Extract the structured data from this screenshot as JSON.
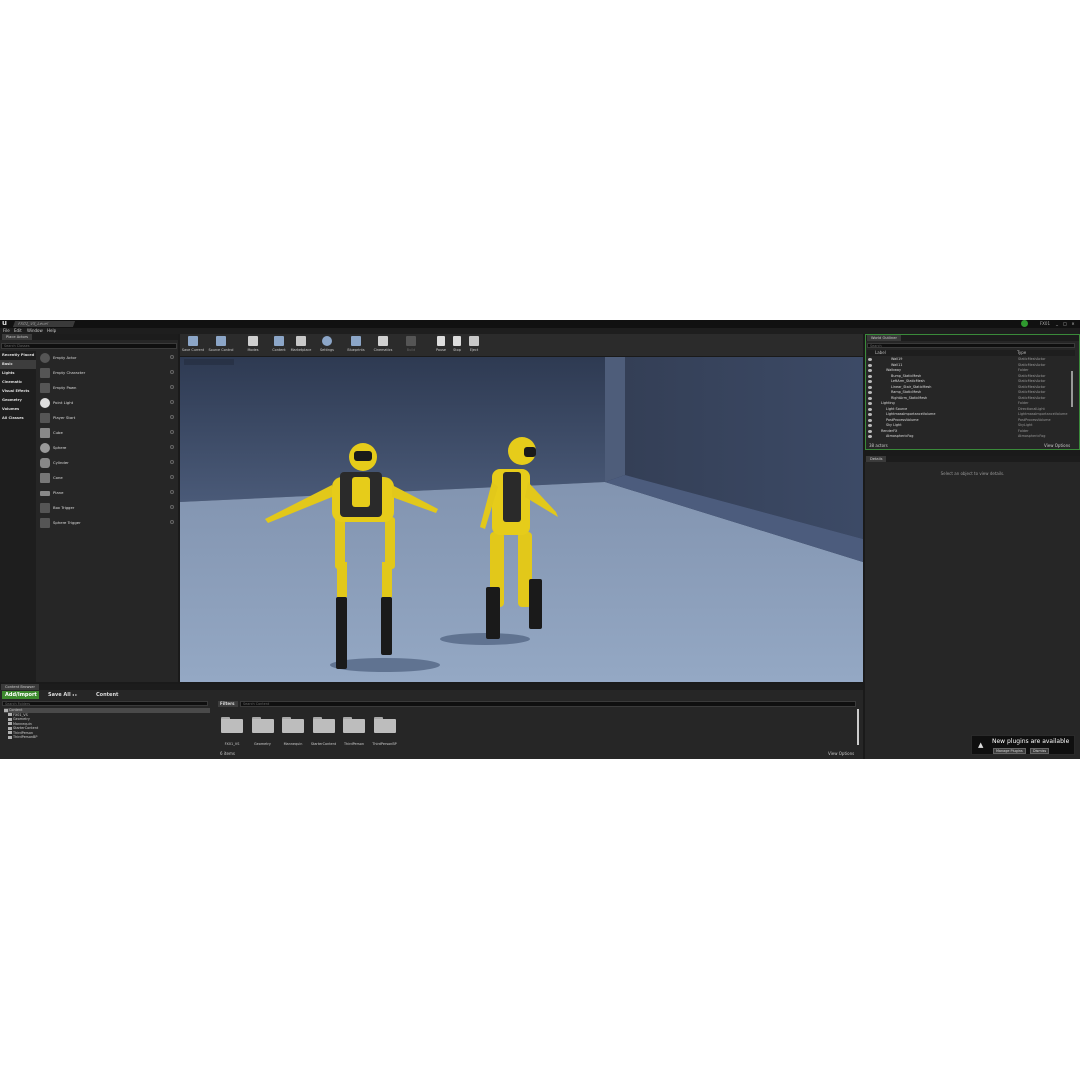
{
  "window": {
    "logo": "u",
    "level_tab": "FX01_VS_Level",
    "project_name": "FX01",
    "controls": [
      "_",
      "□",
      "×"
    ]
  },
  "menu": [
    "File",
    "Edit",
    "Window",
    "Help"
  ],
  "place_actors": {
    "tab": "Place Actors",
    "search_placeholder": "Search Classes",
    "categories": [
      "Recently Placed",
      "Basic",
      "Lights",
      "Cinematic",
      "Visual Effects",
      "Geometry",
      "Volumes",
      "All Classes"
    ],
    "selected_category": "Basic",
    "items": [
      "Empty Actor",
      "Empty Character",
      "Empty Pawn",
      "Point Light",
      "Player Start",
      "Cube",
      "Sphere",
      "Cylinder",
      "Cone",
      "Plane",
      "Box Trigger",
      "Sphere Trigger"
    ]
  },
  "toolbar": {
    "buttons": [
      "Save Current",
      "Source Control",
      "Modes",
      "Content",
      "Marketplace",
      "Settings",
      "Blueprints",
      "Cinematics",
      "Build",
      "Pause",
      "Stop",
      "Eject"
    ]
  },
  "world_outliner": {
    "tab": "World Outliner",
    "search_placeholder": "Search",
    "col_label": "Label",
    "col_type": "Type",
    "rows": [
      {
        "label": "Wall19",
        "type": "StaticMeshActor",
        "indent": 3
      },
      {
        "label": "Wall11",
        "type": "StaticMeshActor",
        "indent": 3
      },
      {
        "label": "Walkway",
        "type": "Folder",
        "indent": 2
      },
      {
        "label": "Bump_StaticMesh",
        "type": "StaticMeshActor",
        "indent": 3
      },
      {
        "label": "LeftArm_StaticMesh",
        "type": "StaticMeshActor",
        "indent": 3
      },
      {
        "label": "Linear_Stair_StaticMesh",
        "type": "StaticMeshActor",
        "indent": 3
      },
      {
        "label": "Ramp_StaticMesh",
        "type": "StaticMeshActor",
        "indent": 3
      },
      {
        "label": "RightArm_StaticMesh",
        "type": "StaticMeshActor",
        "indent": 3
      },
      {
        "label": "Lighting",
        "type": "Folder",
        "indent": 1
      },
      {
        "label": "Light Source",
        "type": "DirectionalLight",
        "indent": 2
      },
      {
        "label": "LightmassImportanceVolume",
        "type": "LightmassImportanceVolume",
        "indent": 2
      },
      {
        "label": "PostProcessVolume",
        "type": "PostProcessVolume",
        "indent": 2
      },
      {
        "label": "Sky Light",
        "type": "SkyLight",
        "indent": 2
      },
      {
        "label": "RenderFX",
        "type": "Folder",
        "indent": 1
      },
      {
        "label": "AtmosphericFog",
        "type": "AtmosphericFog",
        "indent": 2
      }
    ],
    "count": "38 actors",
    "view_options": "View Options"
  },
  "details": {
    "tab": "Details",
    "empty_message": "Select an object to view details."
  },
  "content_browser": {
    "tab": "Content Browser",
    "add_import": "Add/Import",
    "save_all": "Save All",
    "path_root": "Content",
    "search_folders_placeholder": "Search Folders",
    "filters": "Filters",
    "search_content_placeholder": "Search Content",
    "tree": [
      "Content",
      "FX01_VS",
      "Geometry",
      "Mannequin",
      "StarterContent",
      "ThirdPerson",
      "ThirdPersonBP"
    ],
    "folders": [
      "FX01_VS",
      "Geometry",
      "Mannequin",
      "StarterContent",
      "ThirdPerson",
      "ThirdPersonBP"
    ],
    "item_count": "6 items",
    "view_options": "View Options"
  },
  "notification": {
    "message": "New plugins are available",
    "manage_button": "Manage Plugins",
    "dismiss_button": "Dismiss"
  },
  "colors": {
    "accent_green": "#3a8a3a",
    "suit_yellow": "#e6cc1a",
    "floor": "#8ba0bd",
    "wall": "#3d4c68"
  }
}
